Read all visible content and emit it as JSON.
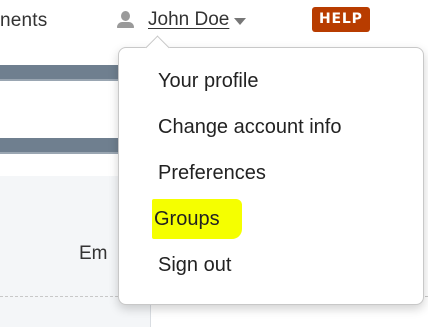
{
  "header": {
    "nav_partial_label": "nents",
    "user": {
      "name": "John Doe",
      "icon": "user-icon"
    },
    "help_label": "HELP"
  },
  "page": {
    "column_header_partial": "Em",
    "fragment_text": ""
  },
  "user_dropdown": {
    "items": [
      {
        "label": "Your profile"
      },
      {
        "label": "Change account info"
      },
      {
        "label": "Preferences"
      },
      {
        "label": "Groups",
        "highlighted": true
      },
      {
        "label": "Sign out"
      }
    ]
  },
  "colors": {
    "help_badge": "#b83c00",
    "highlight": "#f5ff00",
    "text": "#333333"
  }
}
